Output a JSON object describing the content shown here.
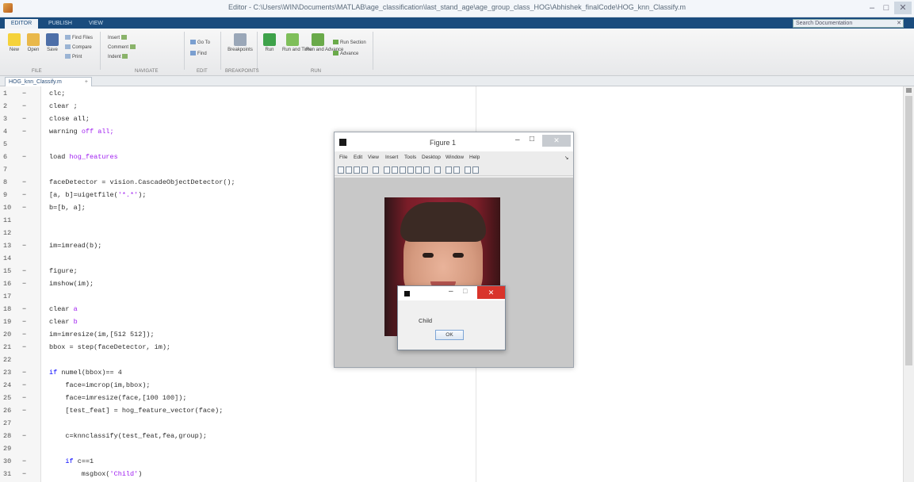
{
  "window": {
    "title": "Editor - C:\\Users\\WIN\\Documents\\MATLAB\\age_classification\\last_stand_age\\age_group_class_HOG\\Abhishek_finalCode\\HOG_knn_Classify.m",
    "min_glyph": "–",
    "max_glyph": "□",
    "close_glyph": "✕"
  },
  "ribbon": {
    "tabs": [
      "EDITOR",
      "PUBLISH",
      "VIEW"
    ],
    "search_placeholder": "Search Documentation",
    "accent": "#1a4c7e",
    "buttons": [
      {
        "label": "New",
        "icon": "new-file-icon"
      },
      {
        "label": "Open",
        "icon": "open-folder-icon"
      },
      {
        "label": "Save",
        "icon": "save-icon"
      }
    ],
    "file_small": [
      "Find Files",
      "Compare",
      "Print"
    ],
    "nav_small": [
      "Insert",
      "Comment",
      "Indent"
    ],
    "edit_small": [
      "Go To",
      "Find"
    ],
    "run_buttons": [
      {
        "label": "Breakpoints",
        "icon": "breakpoints-icon"
      },
      {
        "label": "Run",
        "icon": "run-icon"
      },
      {
        "label": "Run and Time",
        "icon": "run-and-time-icon"
      },
      {
        "label": "Run and Advance",
        "icon": "run-and-advance-icon"
      }
    ],
    "run_small": [
      "Run Section",
      "Advance"
    ],
    "section_labels": [
      "FILE",
      "NAVIGATE",
      "EDIT",
      "BREAKPOINTS",
      "RUN"
    ]
  },
  "file_tab": {
    "label": "HOG_knn_Classify.m",
    "add_glyph": "+"
  },
  "editor": {
    "lines": [
      {
        "n": "1",
        "dash": "−",
        "text": "clc;"
      },
      {
        "n": "2",
        "dash": "−",
        "text": "clear ;"
      },
      {
        "n": "3",
        "dash": "−",
        "text": "close all;"
      },
      {
        "n": "4",
        "dash": "−",
        "text_parts": [
          "warning ",
          "off all;"
        ]
      },
      {
        "n": "5",
        "dash": "",
        "text": ""
      },
      {
        "n": "6",
        "dash": "−",
        "text_parts": [
          "load ",
          "hog_features"
        ]
      },
      {
        "n": "7",
        "dash": "",
        "text": ""
      },
      {
        "n": "8",
        "dash": "−",
        "text": "faceDetector = vision.CascadeObjectDetector();"
      },
      {
        "n": "9",
        "dash": "−",
        "text_parts": [
          "[a, b]=uigetfile(",
          "'*.*'",
          ");"
        ]
      },
      {
        "n": "10",
        "dash": "−",
        "text": "b=[b, a];"
      },
      {
        "n": "11",
        "dash": "",
        "text": ""
      },
      {
        "n": "12",
        "dash": "",
        "text": ""
      },
      {
        "n": "13",
        "dash": "−",
        "text": "im=imread(b);"
      },
      {
        "n": "14",
        "dash": "",
        "text": ""
      },
      {
        "n": "15",
        "dash": "−",
        "text": "figure;"
      },
      {
        "n": "16",
        "dash": "−",
        "text": "imshow(im);"
      },
      {
        "n": "17",
        "dash": "",
        "text": ""
      },
      {
        "n": "18",
        "dash": "−",
        "text_parts": [
          "clear ",
          "a"
        ]
      },
      {
        "n": "19",
        "dash": "−",
        "text_parts": [
          "clear ",
          "b"
        ]
      },
      {
        "n": "20",
        "dash": "−",
        "text": "im=imresize(im,[512 512]);"
      },
      {
        "n": "21",
        "dash": "−",
        "text": "bbox = step(faceDetector, im);"
      },
      {
        "n": "22",
        "dash": "",
        "text": ""
      },
      {
        "n": "23",
        "dash": "−",
        "text_parts": [
          "if ",
          "numel(bbox)== 4"
        ]
      },
      {
        "n": "24",
        "dash": "−",
        "text": "    face=imcrop(im,bbox);"
      },
      {
        "n": "25",
        "dash": "−",
        "text": "    face=imresize(face,[100 100]);"
      },
      {
        "n": "26",
        "dash": "−",
        "text": "    [test_feat] = hog_feature_vector(face);"
      },
      {
        "n": "27",
        "dash": "",
        "text": ""
      },
      {
        "n": "28",
        "dash": "−",
        "text": "    c=knnclassify(test_feat,fea,group);"
      },
      {
        "n": "29",
        "dash": "",
        "text": ""
      },
      {
        "n": "30",
        "dash": "−",
        "text_parts": [
          "    ",
          "if ",
          "c==1"
        ]
      },
      {
        "n": "31",
        "dash": "−",
        "text_parts": [
          "        msgbox(",
          "'Child'",
          ")"
        ]
      }
    ]
  },
  "figure": {
    "title": "Figure 1",
    "menu": [
      "File",
      "Edit",
      "View",
      "Insert",
      "Tools",
      "Desktop",
      "Window",
      "Help"
    ],
    "menu_arrow": "↘",
    "min_glyph": "–",
    "max_glyph": "□",
    "close_glyph": "✕"
  },
  "msgbox": {
    "text": "Child",
    "ok_label": "OK",
    "min_glyph": "–",
    "max_glyph": "□",
    "close_glyph": "✕",
    "close_color": "#d9342b"
  }
}
